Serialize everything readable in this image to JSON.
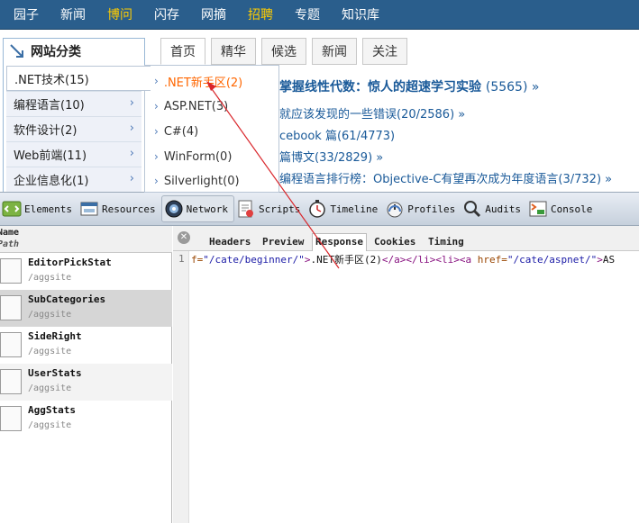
{
  "topnav": {
    "items": [
      "园子",
      "新闻",
      "博问",
      "闪存",
      "网摘",
      "招聘",
      "专题",
      "知识库"
    ]
  },
  "sidebar": {
    "title": "网站分类",
    "categories": [
      ".NET技术(15)",
      "编程语言(10)",
      "软件设计(2)",
      "Web前端(11)",
      "企业信息化(1)"
    ]
  },
  "dropdown": {
    "items": [
      ".NET新手区(2)",
      "ASP.NET(3)",
      "C#(4)",
      "WinForm(0)",
      "Silverlight(0)"
    ]
  },
  "tabs": [
    "首页",
    "精华",
    "候选",
    "新闻",
    "关注"
  ],
  "articles": [
    {
      "title": "掌握线性代数：惊人的超速学习实验 ",
      "count": "(5565) »"
    },
    {
      "title": "就应该发现的一些错误(20/2586) »"
    },
    {
      "title": "cebook 篇(61/4773)"
    },
    {
      "title": "篇博文(33/2829) »"
    },
    {
      "title": "编程语言排行榜：Objective-C有望再次成为年度语言(3/732) »"
    }
  ],
  "devtools": {
    "tabs": [
      "Elements",
      "Resources",
      "Network",
      "Scripts",
      "Timeline",
      "Profiles",
      "Audits",
      "Console"
    ],
    "columns": {
      "name": "Name",
      "path": "Path"
    },
    "requests": [
      {
        "name": "EditorPickStat",
        "path": "/aggsite"
      },
      {
        "name": "SubCategories",
        "path": "/aggsite"
      },
      {
        "name": "SideRight",
        "path": "/aggsite"
      },
      {
        "name": "UserStats",
        "path": "/aggsite"
      },
      {
        "name": "AggStats",
        "path": "/aggsite"
      }
    ],
    "detail_tabs": [
      "Headers",
      "Preview",
      "Response",
      "Cookies",
      "Timing"
    ],
    "response": {
      "line_no": "1",
      "code_parts": [
        "f=",
        "\"/cate/beginner/\"",
        ">",
        ".NET新手区(2)",
        "</a></li><li><a ",
        "href=",
        "\"/cate/aspnet/\"",
        ">",
        "AS"
      ]
    }
  },
  "colors": {
    "topnav_bg": "#2a5e8c",
    "highlight": "#ffcc00",
    "active_sub": "#ff6600",
    "link": "#1a5a99",
    "arrow": "#d9262b"
  }
}
